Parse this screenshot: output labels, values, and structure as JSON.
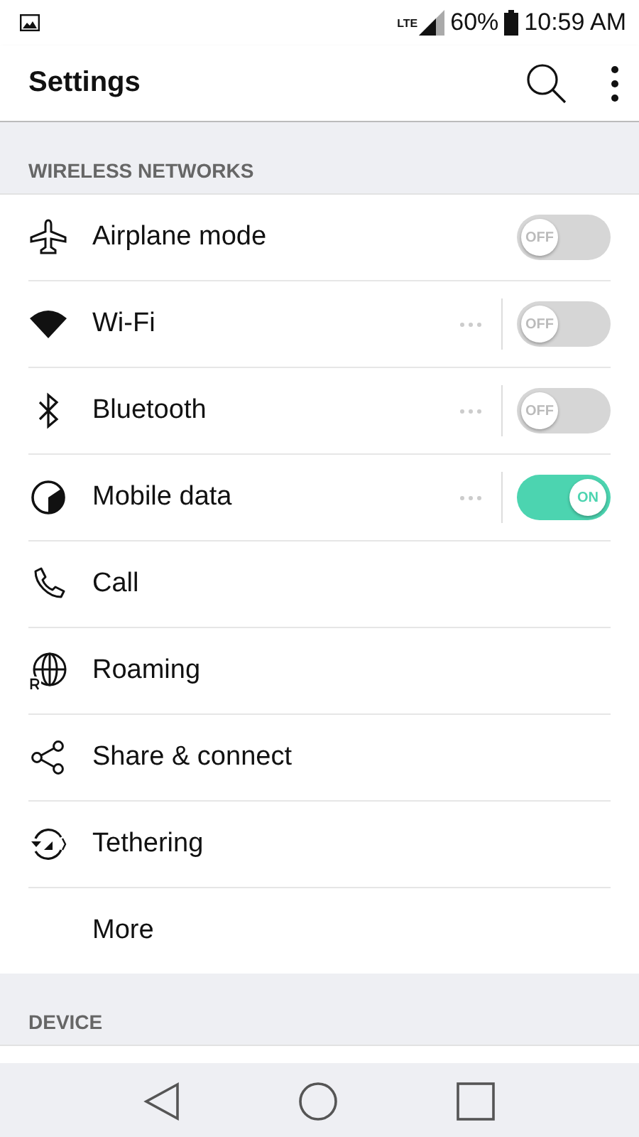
{
  "status_bar": {
    "network": "LTE",
    "battery": "60%",
    "time": "10:59 AM"
  },
  "app_bar": {
    "title": "Settings"
  },
  "sections": [
    {
      "title": "WIRELESS NETWORKS",
      "items": [
        {
          "label": "Airplane mode",
          "kind": "switch",
          "on": false,
          "switch_text": "OFF",
          "more": false
        },
        {
          "label": "Wi-Fi",
          "kind": "switch",
          "on": false,
          "switch_text": "OFF",
          "more": true
        },
        {
          "label": "Bluetooth",
          "kind": "switch",
          "on": false,
          "switch_text": "OFF",
          "more": true
        },
        {
          "label": "Mobile data",
          "kind": "switch",
          "on": true,
          "switch_text": "ON",
          "more": true
        },
        {
          "label": "Call",
          "kind": "link"
        },
        {
          "label": "Roaming",
          "kind": "link"
        },
        {
          "label": "Share & connect",
          "kind": "link"
        },
        {
          "label": "Tethering",
          "kind": "link"
        },
        {
          "label": "More",
          "kind": "link"
        }
      ]
    },
    {
      "title": "DEVICE"
    }
  ]
}
